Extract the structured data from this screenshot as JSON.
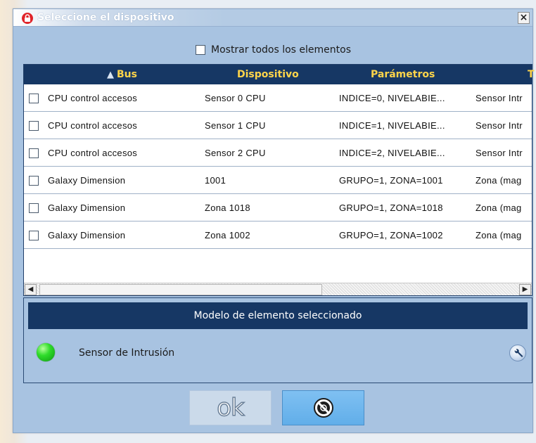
{
  "window": {
    "title": "Seleccione el dispositivo",
    "close_label": "×"
  },
  "show_all": {
    "label": "Mostrar todos los elementos",
    "checked": false
  },
  "table": {
    "columns": [
      {
        "label": "Bus",
        "sorted": "ascending"
      },
      {
        "label": "Dispositivo"
      },
      {
        "label": "Parámetros"
      },
      {
        "label": "T"
      }
    ],
    "rows": [
      {
        "bus": "CPU control accesos",
        "device": "Sensor 0 CPU",
        "params": "INDICE=0, NIVELABIE...",
        "type": "Sensor Intr"
      },
      {
        "bus": "CPU control accesos",
        "device": "Sensor 1 CPU",
        "params": "INDICE=1, NIVELABIE...",
        "type": "Sensor Intr"
      },
      {
        "bus": "CPU control accesos",
        "device": "Sensor 2 CPU",
        "params": "INDICE=2, NIVELABIE...",
        "type": "Sensor Intr"
      },
      {
        "bus": "Galaxy Dimension",
        "device": "1001",
        "params": "GRUPO=1, ZONA=1001",
        "type": "Zona (mag"
      },
      {
        "bus": "Galaxy Dimension",
        "device": "Zona 1018",
        "params": "GRUPO=1, ZONA=1018",
        "type": "Zona (mag"
      },
      {
        "bus": "Galaxy Dimension",
        "device": "Zona 1002",
        "params": "GRUPO=1, ZONA=1002",
        "type": "Zona (mag"
      }
    ]
  },
  "scrollbar": {
    "left_arrow": "◀",
    "right_arrow": "▶"
  },
  "model": {
    "header": "Modelo de elemento seleccionado",
    "name": "Sensor de Intrusión",
    "status_color": "#2fdc2a"
  },
  "buttons": {
    "ok_label": "ok"
  },
  "icons": {
    "title": "lock-icon",
    "sort": "sort-ascending-icon",
    "status": "green-led-icon",
    "config": "wrench-icon",
    "cancel": "cancel-icon"
  },
  "colors": {
    "header_bg": "#163764",
    "header_text": "#ffd54a",
    "dialog_bg": "#a8c3e1",
    "cancel_btn": "#6bb4ec"
  }
}
